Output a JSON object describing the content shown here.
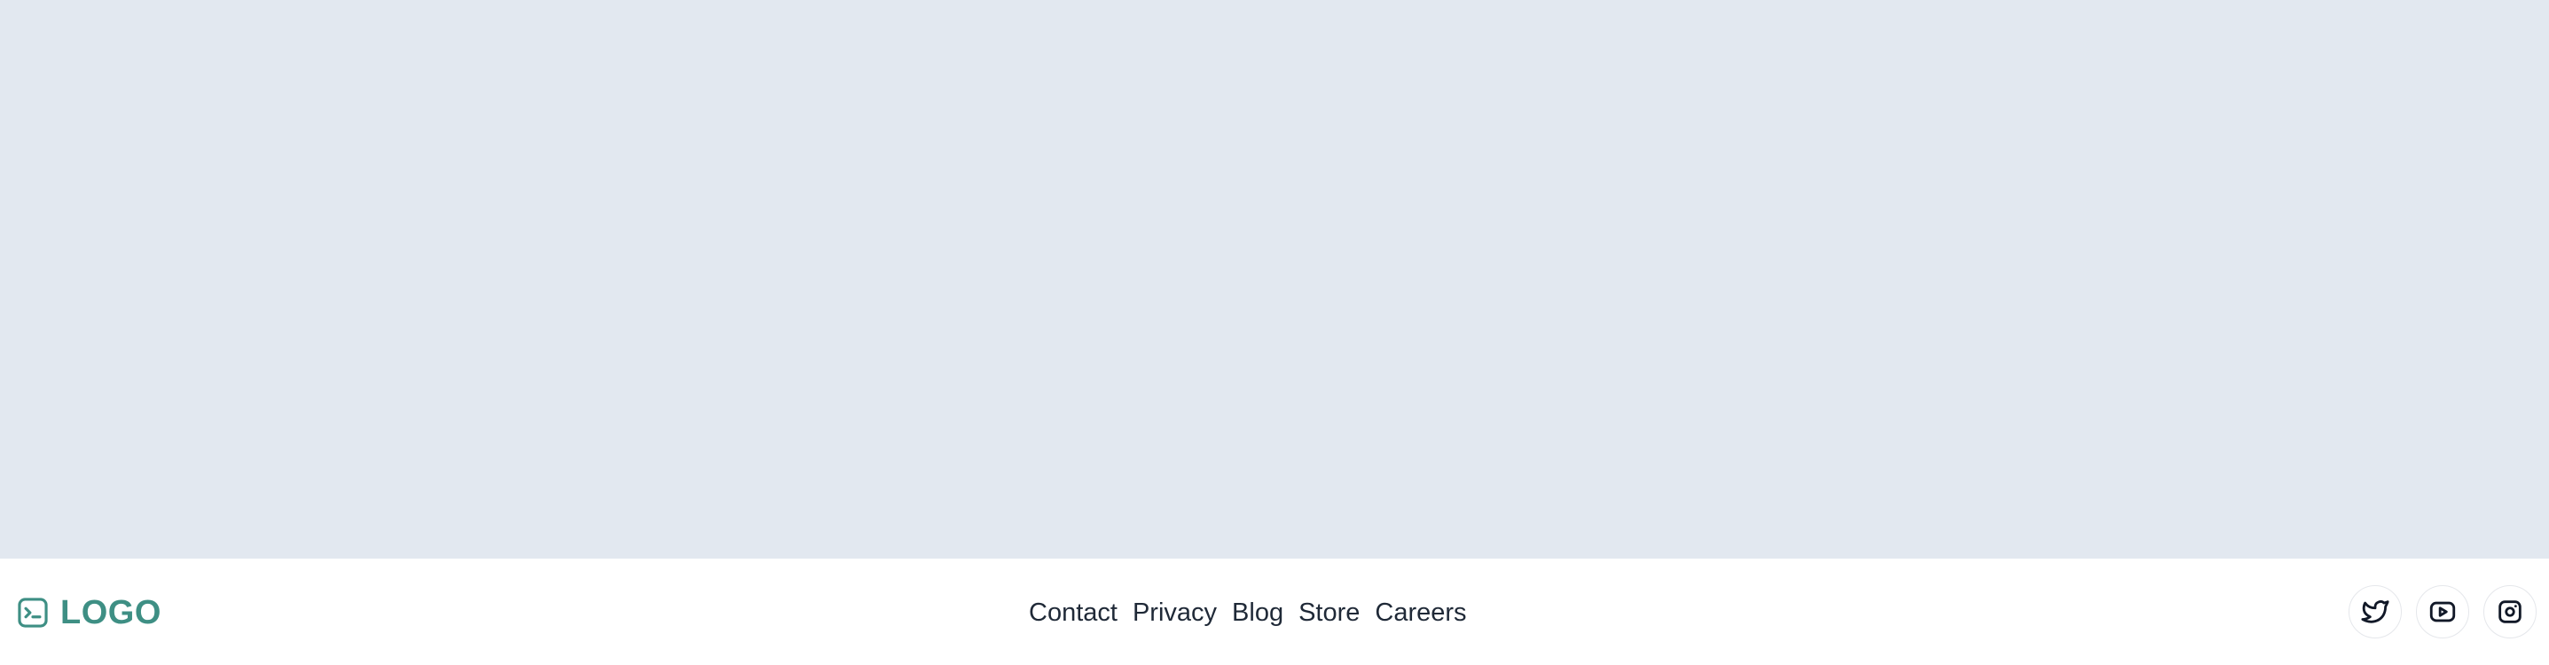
{
  "brand": {
    "logo_text": "LOGO",
    "logo_icon": "terminal-square-icon",
    "accent_color": "#3e8f84"
  },
  "hero": {
    "background_color": "#e2e8f0"
  },
  "footer": {
    "nav_links": [
      {
        "label": "Contact"
      },
      {
        "label": "Privacy"
      },
      {
        "label": "Blog"
      },
      {
        "label": "Store"
      },
      {
        "label": "Careers"
      }
    ],
    "social": [
      {
        "icon": "twitter-icon"
      },
      {
        "icon": "youtube-icon"
      },
      {
        "icon": "instagram-icon"
      }
    ]
  }
}
